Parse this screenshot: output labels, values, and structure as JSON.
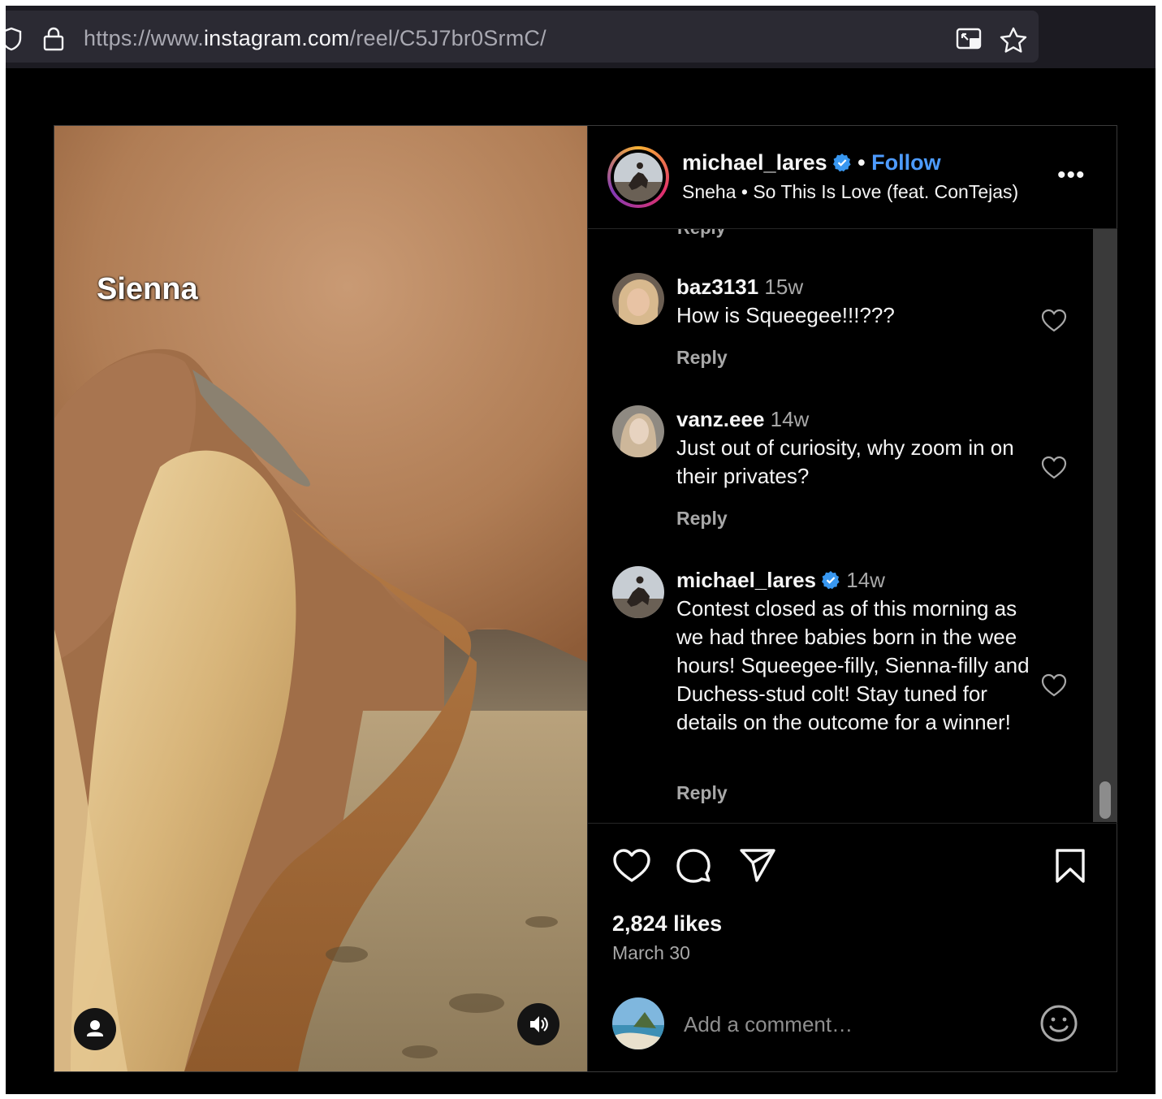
{
  "browser": {
    "url_prefix": "https://www.",
    "url_domain": "instagram.com",
    "url_path": "/reel/C5J7br0SrmC/"
  },
  "media": {
    "overlay_label": "Sienna"
  },
  "header": {
    "username": "michael_lares",
    "separator": " • ",
    "follow": "Follow",
    "song": "Sneha • So This Is Love (feat. ConTejas)",
    "more": "•••"
  },
  "comments": {
    "cut_reply": "Reply",
    "items": [
      {
        "username": "baz3131",
        "time": "15w",
        "text": "How is Squeegee!!!???",
        "reply": "Reply"
      },
      {
        "username": "vanz.eee",
        "time": "14w",
        "text": "Just out of curiosity, why zoom in on their privates?",
        "reply": "Reply"
      },
      {
        "username": "michael_lares",
        "time": "14w",
        "text": "Contest closed as of this morning as we had three babies born in the wee hours! Squeegee-filly, Sienna-filly and Duchess-stud colt! Stay tuned for details on the outcome for a winner!",
        "reply": "Reply"
      }
    ]
  },
  "footer": {
    "likes": "2,824 likes",
    "date": "March 30",
    "comment_placeholder": "Add a comment…"
  },
  "icons": {
    "shield": "shield-icon",
    "lock": "lock-icon",
    "pip": "picture-in-picture-icon",
    "bookmark_star": "star-icon",
    "user": "user-icon",
    "volume": "volume-icon",
    "verified": "verified-badge-icon",
    "heart": "heart-icon",
    "comment": "comment-icon",
    "share": "share-icon",
    "save": "save-icon",
    "emoji": "emoji-icon"
  },
  "colors": {
    "background": "#000000",
    "link_blue": "#4d9bff",
    "verified_blue": "#3897f0",
    "muted_text": "#a8a8a8"
  }
}
